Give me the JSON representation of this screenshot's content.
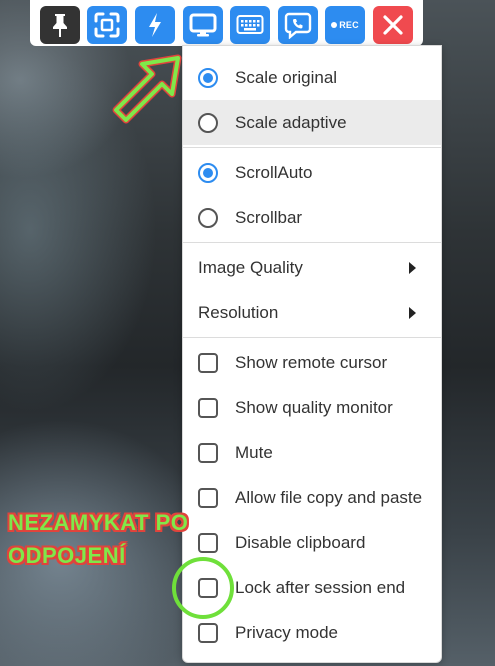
{
  "toolbar": {
    "buttons": [
      {
        "name": "pin-button",
        "icon": "pin-icon"
      },
      {
        "name": "fullscreen-button",
        "icon": "fullscreen-icon"
      },
      {
        "name": "action-button",
        "icon": "lightning-icon"
      },
      {
        "name": "display-button",
        "icon": "monitor-icon"
      },
      {
        "name": "keyboard-button",
        "icon": "keyboard-icon"
      },
      {
        "name": "chat-button",
        "icon": "chat-phone-icon"
      },
      {
        "name": "record-button",
        "icon": "record-icon"
      },
      {
        "name": "close-button",
        "icon": "close-icon"
      }
    ],
    "rec_label": "REC",
    "colors": {
      "accent": "#2d8cf0",
      "pin": "#333333",
      "close": "#f04a4f"
    }
  },
  "menu": {
    "scale": [
      {
        "label": "Scale original",
        "selected": true
      },
      {
        "label": "Scale adaptive",
        "selected": false,
        "highlighted": true
      }
    ],
    "scroll": [
      {
        "label": "ScrollAuto",
        "selected": true
      },
      {
        "label": "Scrollbar",
        "selected": false
      }
    ],
    "submenus": [
      {
        "label": "Image Quality"
      },
      {
        "label": "Resolution"
      }
    ],
    "toggles": [
      {
        "label": "Show remote cursor",
        "checked": false
      },
      {
        "label": "Show quality monitor",
        "checked": false
      },
      {
        "label": "Mute",
        "checked": false
      },
      {
        "label": "Allow file copy and paste",
        "checked": false
      },
      {
        "label": "Disable clipboard",
        "checked": false
      },
      {
        "label": "Lock after session end",
        "checked": false
      },
      {
        "label": "Privacy mode",
        "checked": false
      }
    ]
  },
  "annotation": {
    "line1": "NEZAMYKAT PO",
    "line2": "ODPOJENÍ",
    "color": "#7fe84a",
    "outline": "#e0443c"
  }
}
